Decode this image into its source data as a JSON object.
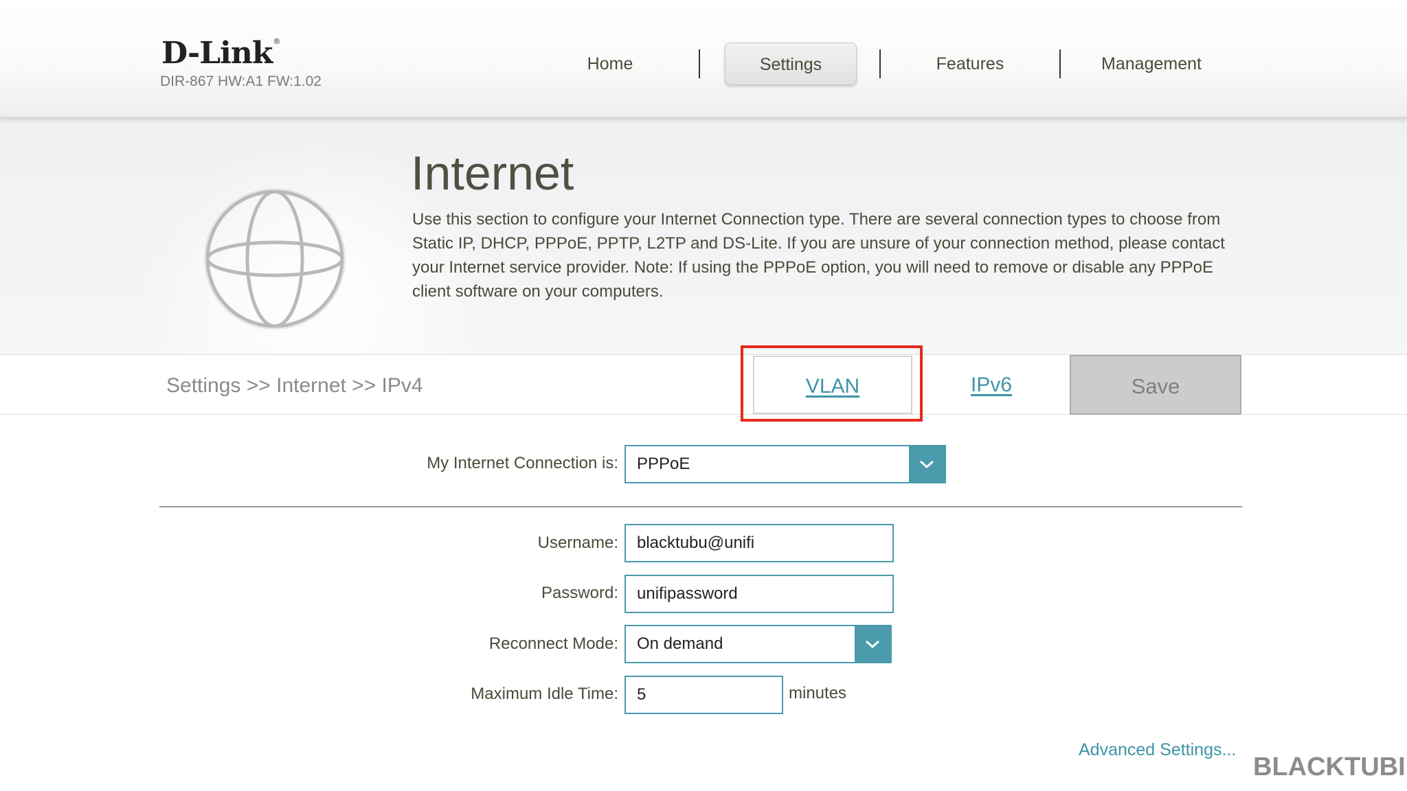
{
  "header": {
    "logo_text": "D-Link",
    "logo_mark": "®",
    "model_info": "DIR-867 HW:A1 FW:1.02",
    "nav": [
      {
        "label": "Home",
        "active": false
      },
      {
        "label": "Settings",
        "active": true
      },
      {
        "label": "Features",
        "active": false
      },
      {
        "label": "Management",
        "active": false
      }
    ]
  },
  "banner": {
    "icon": "globe-icon",
    "title": "Internet",
    "description": "Use this section to configure your Internet Connection type. There are several connection types to choose from Static IP, DHCP, PPPoE, PPTP, L2TP and DS-Lite. If you are unsure of your connection method, please contact your Internet service provider. Note: If using the PPPoE option, you will need to remove or disable any PPPoE client software on your computers."
  },
  "toolbar": {
    "breadcrumb": "Settings >> Internet >> IPv4",
    "vlan_label": "VLAN",
    "ipv6_label": "IPv6",
    "save_label": "Save",
    "highlight_color": "#e8291c"
  },
  "form": {
    "connection": {
      "label": "My Internet Connection is:",
      "value": "PPPoE"
    },
    "username": {
      "label": "Username:",
      "value": "blacktubu@unifi"
    },
    "password": {
      "label": "Password:",
      "value": "unifipassword"
    },
    "reconnect_mode": {
      "label": "Reconnect Mode:",
      "value": "On demand"
    },
    "idle_time": {
      "label": "Maximum Idle Time:",
      "value": "5",
      "unit": "minutes"
    },
    "advanced_link": "Advanced Settings..."
  },
  "watermark": "BLACKTUBI",
  "colors": {
    "accent": "#4a9aac",
    "link": "#3d95a8",
    "text": "#4a4a3a"
  }
}
